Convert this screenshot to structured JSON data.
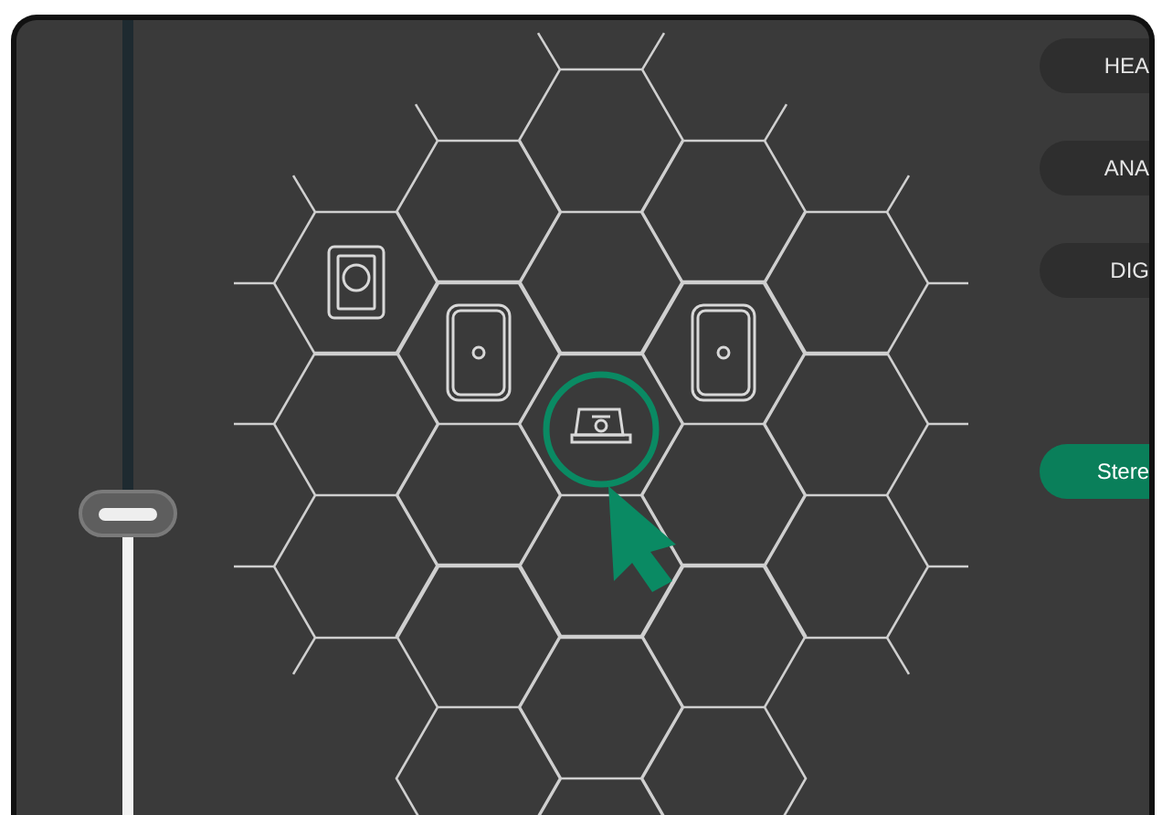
{
  "volume": {
    "level": 0.39
  },
  "speakers": [
    {
      "kind": "subwoofer",
      "selected": false
    },
    {
      "kind": "speaker",
      "selected": false
    },
    {
      "kind": "speaker",
      "selected": false
    },
    {
      "kind": "soundbar",
      "selected": true
    }
  ],
  "outputs": [
    {
      "label": "HEA",
      "selected": false
    },
    {
      "label": "ANA",
      "selected": false
    },
    {
      "label": "DIG",
      "selected": false
    }
  ],
  "modes": [
    {
      "label": "Stere",
      "selected": true
    }
  ]
}
